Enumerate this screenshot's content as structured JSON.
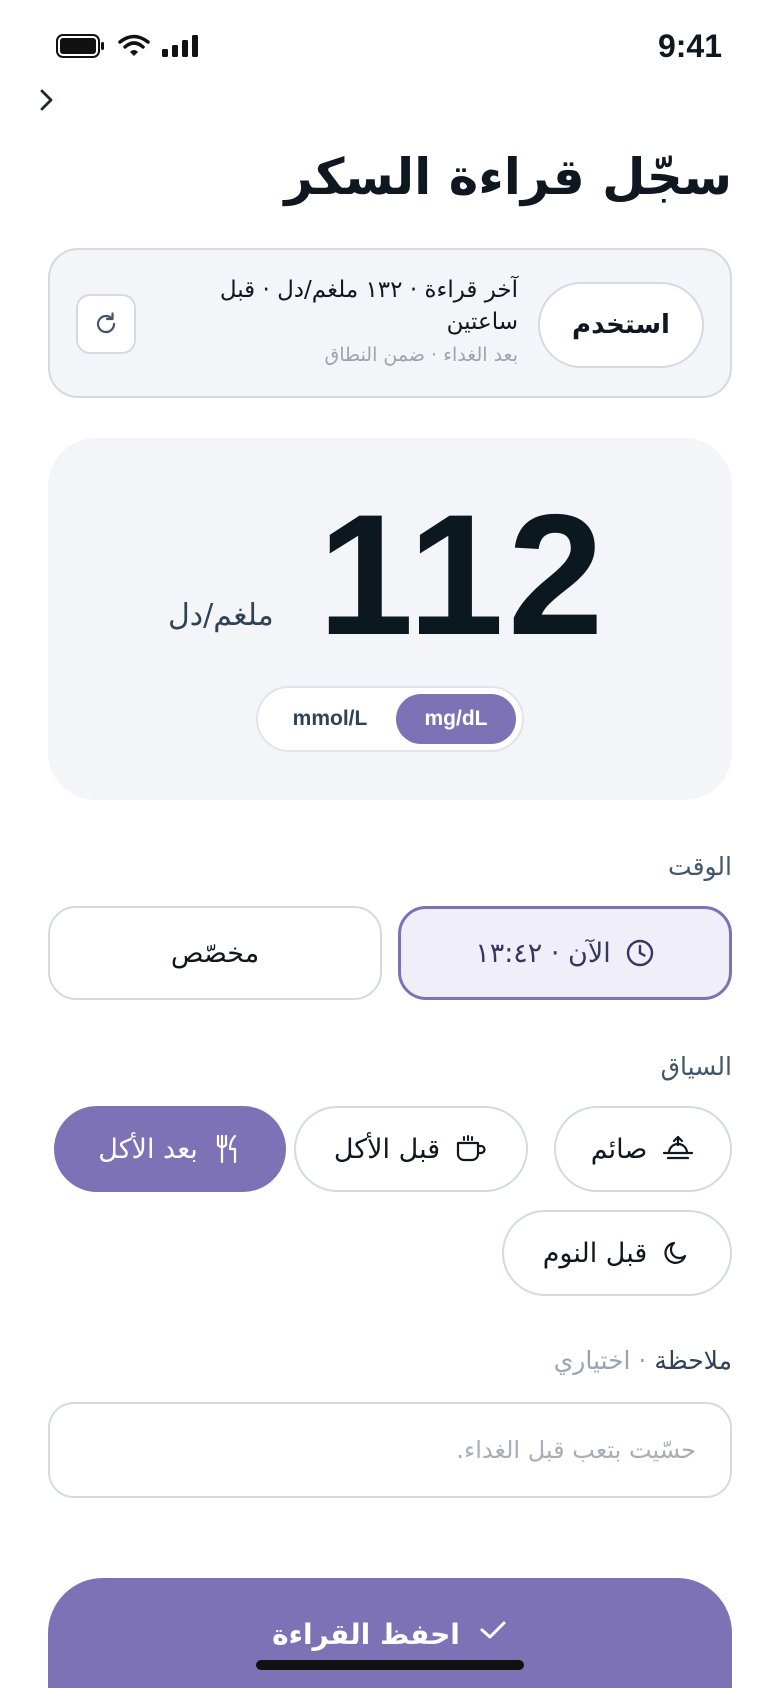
{
  "status_bar": {
    "time": "9:41"
  },
  "header": {
    "title": "سجّل قراءة السكر"
  },
  "last_reading": {
    "text": "آخر قراءة · ١٣٢ ملغم/دل · قبل ساعتين",
    "subtext": "بعد الغداء · ضمن النطاق",
    "use_label": "استخدم"
  },
  "reading": {
    "value": "112",
    "unit": "ملغم/دل",
    "unit_options": {
      "mmol": "mmol/L",
      "mgdl": "mg/dL"
    },
    "selected_unit": "mg/dL"
  },
  "time_section": {
    "label": "الوقت",
    "now_label": "الآن · ١٣:٤٢",
    "custom_label": "مخصّص"
  },
  "context_section": {
    "label": "السياق",
    "chips": [
      {
        "label": "صائم",
        "icon": "sunrise-icon",
        "selected": false
      },
      {
        "label": "قبل الأكل",
        "icon": "cup-icon",
        "selected": false
      },
      {
        "label": "بعد الأكل",
        "icon": "utensils-icon",
        "selected": true
      },
      {
        "label": "قبل النوم",
        "icon": "moon-icon",
        "selected": false
      }
    ]
  },
  "note": {
    "label": "ملاحظة",
    "optional": "· اختياري",
    "placeholder": "حسّيت بتعب قبل الغداء.",
    "value": ""
  },
  "save_button": {
    "label": "احفظ القراءة"
  },
  "colors": {
    "accent": "#7e72b6",
    "accent_light": "#f0eef8",
    "card_bg": "#f3f5f8",
    "text_primary": "#0f1720",
    "text_muted": "#9aa4b0"
  }
}
